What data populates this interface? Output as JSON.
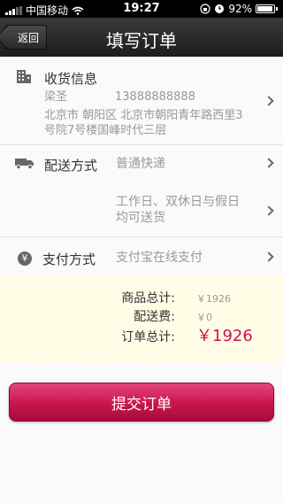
{
  "status_bar": {
    "carrier": "中国移动",
    "time": "19:27",
    "battery": "92%"
  },
  "nav": {
    "back_label": "返回",
    "title": "填写订单"
  },
  "address": {
    "title": "收货信息",
    "name": "梁圣",
    "phone": "13888888888",
    "line1": "北京市 朝阳区  北京市朝阳青年路西里3",
    "line2": "号院7号楼国峰时代三层"
  },
  "delivery": {
    "title": "配送方式",
    "method": "普通快递",
    "time_line1": "工作日、双休日与假日",
    "time_line2": "均可送货"
  },
  "payment": {
    "title": "支付方式",
    "method": "支付宝在线支付"
  },
  "summary": {
    "goods_label": "商品总计:",
    "goods_value": "￥1926",
    "shipping_label": "配送费:",
    "shipping_value": "￥0",
    "total_label": "订单总计:",
    "total_value": "￥1926"
  },
  "submit_label": "提交订单",
  "colors": {
    "accent": "#d1114f",
    "summary_bg": "#fffde6"
  },
  "icons": [
    "signal-icon",
    "wifi-icon",
    "lock-rotation-icon",
    "alarm-icon",
    "battery-icon",
    "building-icon",
    "truck-icon",
    "yen-icon",
    "chevron-right-icon"
  ]
}
